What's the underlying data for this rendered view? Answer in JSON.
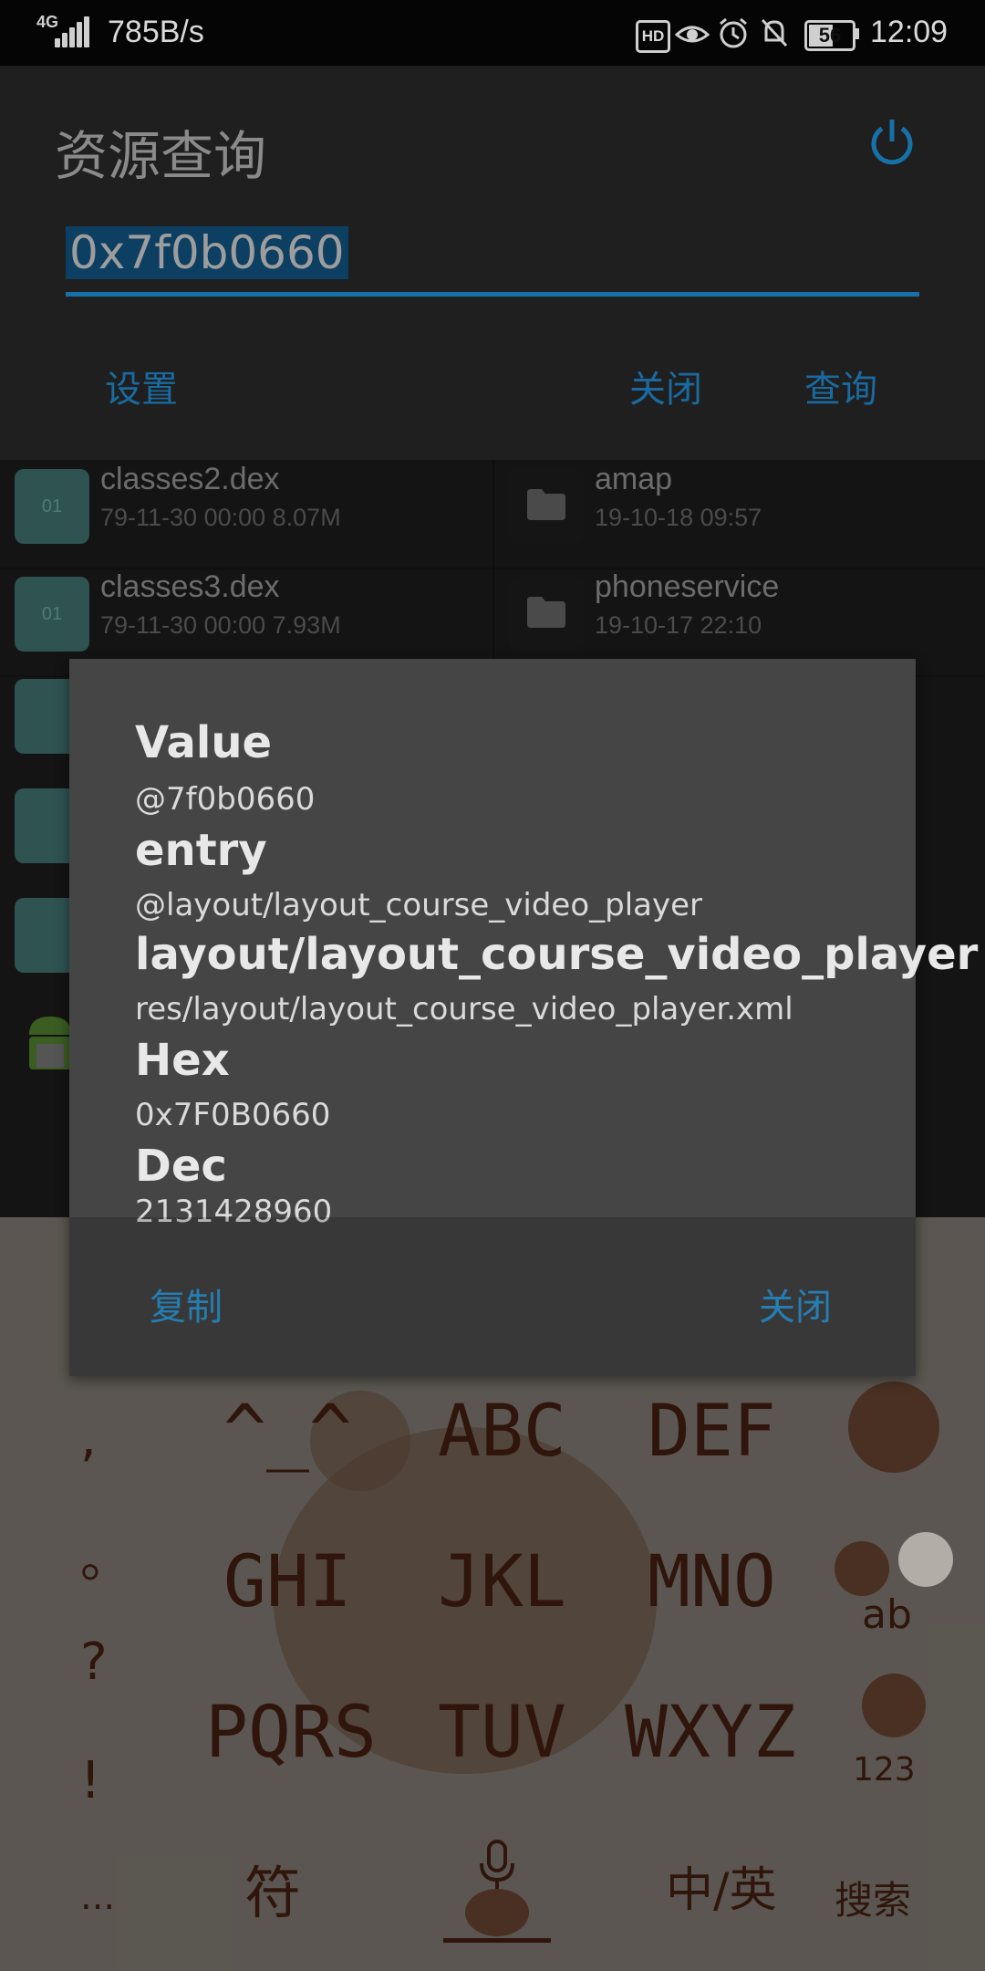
{
  "status_bar": {
    "network": "4G",
    "speed": "785B/s",
    "battery": "56",
    "time": "12:09",
    "icons": [
      "hd-icon",
      "eye-icon",
      "alarm-icon",
      "mute-icon",
      "battery-icon"
    ]
  },
  "app": {
    "title": "资源查询",
    "query_value": "0x7f0b0660",
    "actions": {
      "settings": "设置",
      "close": "关闭",
      "query": "查询"
    }
  },
  "files": [
    {
      "name": "classes2.dex",
      "meta": "79-11-30 00:00  8.07M",
      "type": "file"
    },
    {
      "name": "amap",
      "meta": "19-10-18 09:57",
      "type": "folder"
    },
    {
      "name": "classes3.dex",
      "meta": "79-11-30 00:00  7.93M",
      "type": "file"
    },
    {
      "name": "phoneservice",
      "meta": "19-10-17 22:10",
      "type": "folder"
    }
  ],
  "file_icon_text": "01",
  "dialog": {
    "value_label": "Value",
    "value": "@7f0b0660",
    "entry_label": "entry",
    "entry": "@layout/layout_course_video_player",
    "path_label": "layout/layout_course_video_player",
    "path": "res/layout/layout_course_video_player.xml",
    "hex_label": "Hex",
    "hex": "0x7F0B0660",
    "dec_label": "Dec",
    "dec": "2131428960",
    "copy": "复制",
    "close": "关闭"
  },
  "keyboard": {
    "keys_row1": [
      "^_^",
      "ABC",
      "DEF"
    ],
    "keys_row2": [
      "GHI",
      "JKL",
      "MNO"
    ],
    "keys_row3": [
      "PQRS",
      "TUV",
      "WXYZ"
    ],
    "symbols": [
      ",",
      "。",
      "?",
      "!",
      "..."
    ],
    "bottom": {
      "fu": "符",
      "zh": "中/英",
      "search": "搜索"
    },
    "side": {
      "ab": "ab",
      "num": "123"
    }
  },
  "colors": {
    "accent": "#2e9ad9",
    "dialog_bg": "#454545"
  }
}
